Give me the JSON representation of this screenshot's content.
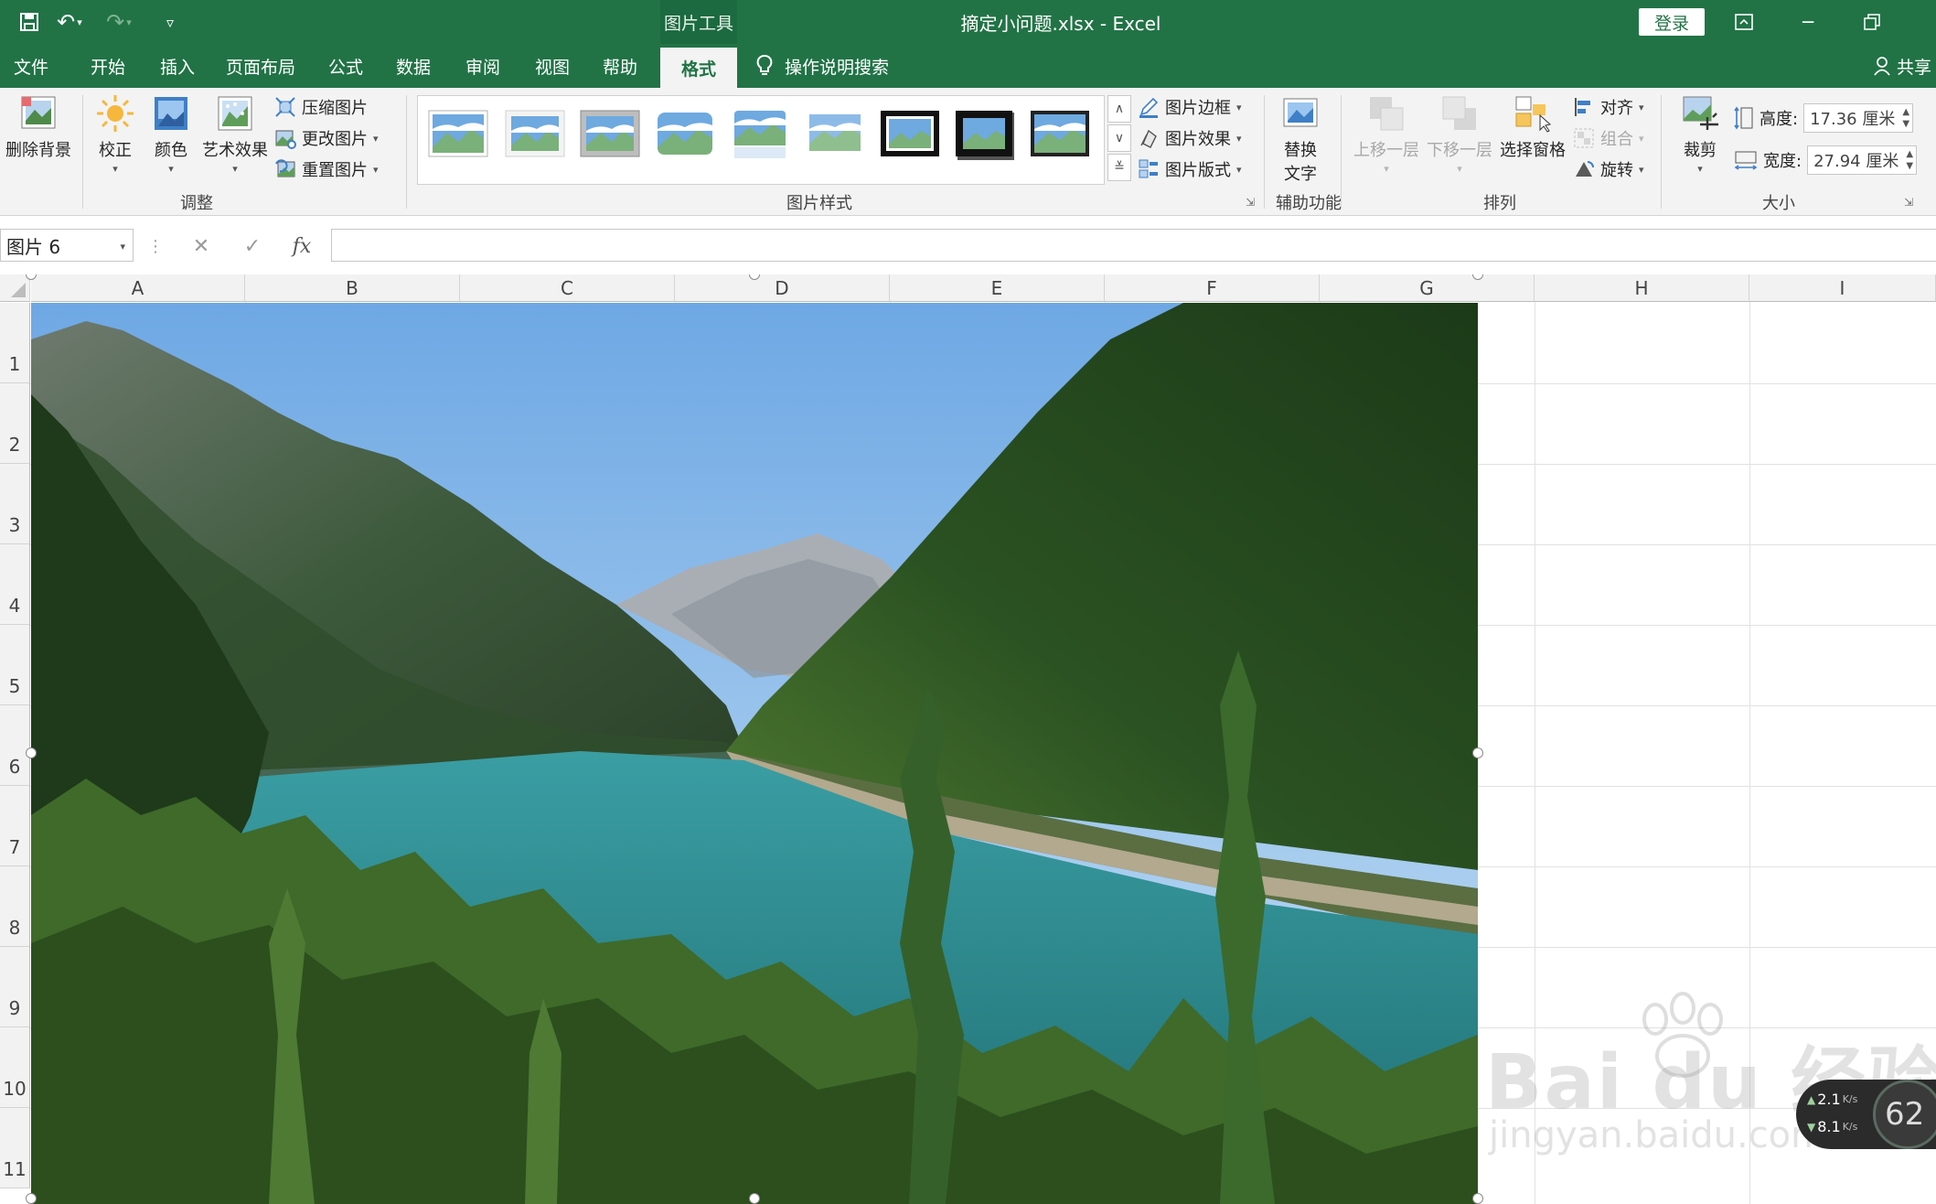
{
  "title_bar": {
    "context_tab": "图片工具",
    "document_title": "摘定小问题.xlsx  -  Excel",
    "login_label": "登录"
  },
  "tabs": [
    {
      "label": "文件",
      "active": false
    },
    {
      "label": "开始",
      "active": false
    },
    {
      "label": "插入",
      "active": false
    },
    {
      "label": "页面布局",
      "active": false
    },
    {
      "label": "公式",
      "active": false
    },
    {
      "label": "数据",
      "active": false
    },
    {
      "label": "审阅",
      "active": false
    },
    {
      "label": "视图",
      "active": false
    },
    {
      "label": "帮助",
      "active": false
    },
    {
      "label": "格式",
      "active": true
    }
  ],
  "tell_me": "操作说明搜索",
  "share_label": "共享",
  "ribbon": {
    "adjust": {
      "remove_background": "删除背景",
      "corrections": "校正",
      "color": "颜色",
      "artistic_effects": "艺术效果",
      "compress": "压缩图片",
      "change": "更改图片",
      "reset": "重置图片",
      "group_label": "调整"
    },
    "styles": {
      "group_label": "图片样式",
      "border": "图片边框",
      "effects": "图片效果",
      "layout": "图片版式"
    },
    "accessibility": {
      "alt_text_line1": "替换",
      "alt_text_line2": "文字",
      "group_label": "辅助功能"
    },
    "arrange": {
      "bring_forward": "上移一层",
      "send_backward": "下移一层",
      "selection_pane": "选择窗格",
      "align": "对齐",
      "group": "组合",
      "rotate": "旋转",
      "group_label": "排列"
    },
    "size": {
      "crop": "裁剪",
      "height_label": "高度:",
      "height_value": "17.36 厘米",
      "width_label": "宽度:",
      "width_value": "27.94 厘米",
      "group_label": "大小"
    }
  },
  "formula_bar": {
    "name_box": "图片 6",
    "fx": "fx",
    "formula": ""
  },
  "grid": {
    "columns": [
      "A",
      "B",
      "C",
      "D",
      "E",
      "F",
      "G",
      "H",
      "I"
    ],
    "rows": [
      "1",
      "2",
      "3",
      "4",
      "5",
      "6",
      "7",
      "8",
      "9",
      "10",
      "11"
    ]
  },
  "watermark": {
    "brand": "Bai du 经验",
    "url": "jingyan.baidu.com"
  },
  "net_widget": {
    "up_speed": "2.1",
    "down_speed": "8.1",
    "unit": "K/s",
    "gauge_value": "62"
  },
  "colors": {
    "excel_green": "#217346",
    "ribbon_bg": "#f3f3f3",
    "sky": "#9cc6ef",
    "lake": "#2c8c8f",
    "forest": "#23461e"
  }
}
